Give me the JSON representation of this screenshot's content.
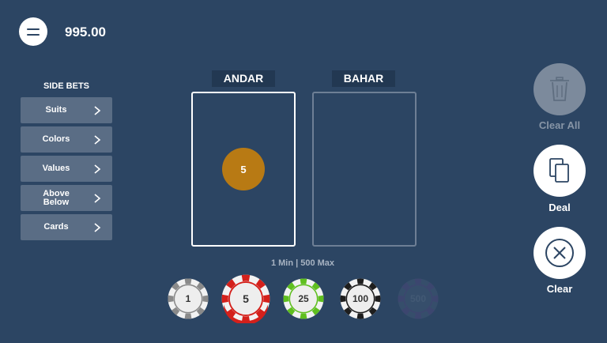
{
  "header": {
    "menu_icon": "hamburger-icon",
    "balance": "995.00"
  },
  "side_bets": {
    "title": "SIDE BETS",
    "items": [
      {
        "label": "Suits"
      },
      {
        "label": "Colors"
      },
      {
        "label": "Values"
      },
      {
        "label": "Above\nBelow"
      },
      {
        "label": "Cards"
      }
    ],
    "chevron_icon": "chevron-right-icon"
  },
  "table": {
    "andar_label": "ANDAR",
    "bahar_label": "BAHAR",
    "andar_bet": "5",
    "limits": "1 Min | 500 Max"
  },
  "chips": [
    {
      "value": "1",
      "color": "#8a8a8a",
      "face": "#eeeeee",
      "text": "#333333",
      "selected": false,
      "enabled": true
    },
    {
      "value": "5",
      "color": "#d4201b",
      "face": "#eeeeee",
      "text": "#333333",
      "selected": true,
      "enabled": true
    },
    {
      "value": "25",
      "color": "#5fbf1f",
      "face": "#eeeeee",
      "text": "#333333",
      "selected": false,
      "enabled": true
    },
    {
      "value": "100",
      "color": "#1e1e1e",
      "face": "#eeeeee",
      "text": "#333333",
      "selected": false,
      "enabled": true
    },
    {
      "value": "500",
      "color": "#5b4a86",
      "face": "#4a5f7a",
      "text": "#6d7f95",
      "selected": false,
      "enabled": false
    }
  ],
  "actions": {
    "clear_all": {
      "label": "Clear All",
      "icon": "trash-icon",
      "enabled": false
    },
    "deal": {
      "label": "Deal",
      "icon": "cards-icon",
      "enabled": true
    },
    "clear": {
      "label": "Clear",
      "icon": "close-circle-icon",
      "enabled": true
    }
  },
  "colors": {
    "background": "#2c4563",
    "tab_background": "#223852",
    "side_bet_button": "#5a6d85",
    "placed_chip": "#b87a14"
  }
}
